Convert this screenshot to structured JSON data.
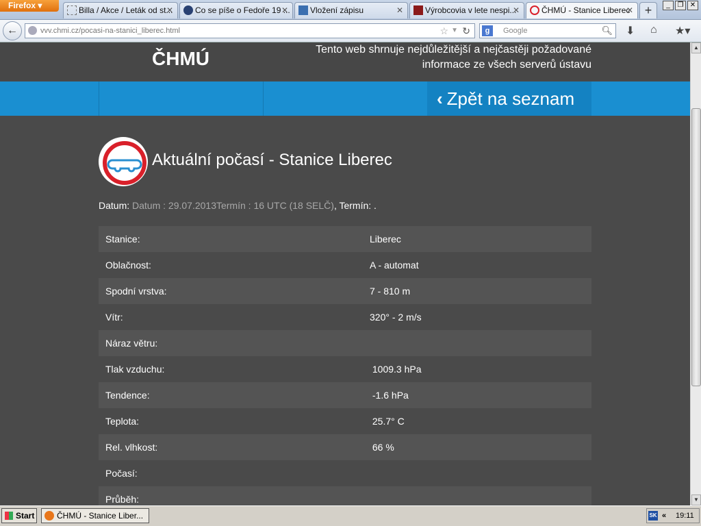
{
  "browser": {
    "menu_button": "Firefox",
    "tabs": [
      {
        "label": "Billa / Akce / Leták od st...",
        "icon": "blank-page-icon"
      },
      {
        "label": "Co se píše o Fedoře 19 ...",
        "icon": "fedora-icon"
      },
      {
        "label": "Vložení zápisu",
        "icon": "bookmark-icon"
      },
      {
        "label": "Výrobcovia v lete nespi...",
        "icon": "mm-icon"
      },
      {
        "label": "ČHMÚ - Stanice Liberec",
        "icon": "chmu-icon"
      }
    ],
    "url": "vvv.chmi.cz/pocasi-na-stanici_liberec.html",
    "search_placeholder": "Google"
  },
  "site": {
    "logo": "ČHMÚ",
    "tagline_line1": "Tento web shrnuje nejdůležitější a nejčastěji požadované",
    "tagline_line2": "informace ze všech serverů ústavu",
    "back_link": "Zpět na seznam"
  },
  "content": {
    "heading": "Aktuální počasí - Stanice Liberec",
    "date_label": "Datum:",
    "date_value": "Datum : 29.07.2013Termín : 16 UTC (18 SELČ)",
    "term_label": ", Termín: ."
  },
  "rows": [
    {
      "key": "Stanice:",
      "value": "Liberec"
    },
    {
      "key": "Oblačnost:",
      "value": "A - automat"
    },
    {
      "key": "Spodní vrstva:",
      "value": "7 - 810 m"
    },
    {
      "key": "Vítr:",
      "value": "320° - 2 m/s"
    },
    {
      "key": "Náraz větru:",
      "value": ""
    },
    {
      "key": "Tlak vzduchu:",
      "value": " 1009.3 hPa"
    },
    {
      "key": "Tendence:",
      "value": " -1.6 hPa"
    },
    {
      "key": "Teplota:",
      "value": " 25.7° C"
    },
    {
      "key": "Rel. vlhkost:",
      "value": " 66 %"
    },
    {
      "key": "Počasí:",
      "value": ""
    },
    {
      "key": "Průběh:",
      "value": ""
    }
  ],
  "taskbar": {
    "start": "Start",
    "item": "ČHMÚ - Stanice Liber...",
    "tray_lang": "SK",
    "time": "19:11"
  }
}
